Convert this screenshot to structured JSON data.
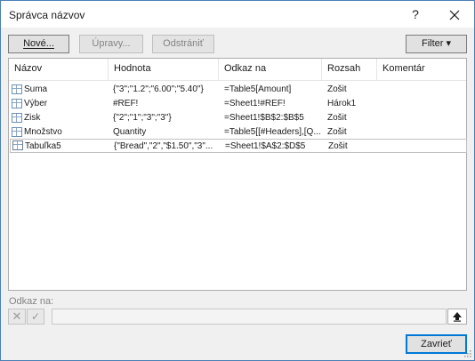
{
  "window": {
    "title": "Správca názvov",
    "help_label": "?",
    "close_label": "✕"
  },
  "toolbar": {
    "new_label": "Nové...",
    "edit_label": "Úpravy...",
    "delete_label": "Odstrániť",
    "filter_label": "Filter ▾"
  },
  "table": {
    "columns": [
      "Názov",
      "Hodnota",
      "Odkaz na",
      "Rozsah",
      "Komentár"
    ],
    "rows": [
      {
        "name": "Suma",
        "value": "{\"3\";\"1.2\";\"6.00\";\"5.40\"}",
        "ref": "=Table5[Amount]",
        "scope": "Zošit",
        "comment": "",
        "icon": "range-name-icon"
      },
      {
        "name": "Výber",
        "value": "#REF!",
        "ref": "=Sheet1!#REF!",
        "scope": "Hárok1",
        "comment": "",
        "icon": "range-name-icon"
      },
      {
        "name": "Zisk",
        "value": "{\"2\";\"1\";\"3\";\"3\"}",
        "ref": "=Sheet1!$B$2:$B$5",
        "scope": "Zošit",
        "comment": "",
        "icon": "range-name-icon"
      },
      {
        "name": "Množstvo",
        "value": "Quantity",
        "ref": "=Table5[[#Headers],[Q...",
        "scope": "Zošit",
        "comment": "",
        "icon": "range-name-icon"
      },
      {
        "name": "Tabuľka5",
        "value": "{\"Bread\",\"2\",\"$1.50\",\"3\"...",
        "ref": "=Sheet1!$A$2:$D$5",
        "scope": "Zošit",
        "comment": "",
        "icon": "table-icon"
      }
    ]
  },
  "footer": {
    "refers_to_label": "Odkaz na:",
    "refers_to_value": "",
    "cancel_symbol": "✕",
    "confirm_symbol": "✓",
    "close_label": "Zavrieť"
  },
  "colors": {
    "accent": "#0078d7",
    "border": "#4a7fb5",
    "background": "#f0f0f0"
  }
}
